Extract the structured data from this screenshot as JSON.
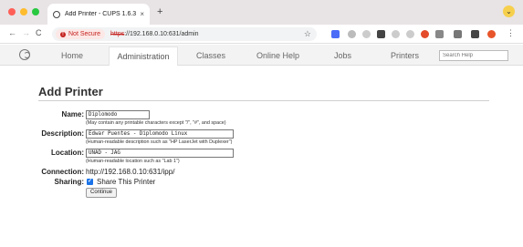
{
  "browser": {
    "tab_title": "Add Printer - CUPS 1.6.3",
    "tab_close": "×",
    "new_tab": "+",
    "security_label": "Not Secure",
    "url_protocol": "https",
    "url_rest": "://192.168.0.10:631/admin",
    "extension_icons": [
      "blue-square",
      "gray",
      "gray",
      "dark",
      "gray",
      "gray",
      "red",
      "gray",
      "gray",
      "gray",
      "red-avatar"
    ]
  },
  "nav": {
    "tabs": [
      "Home",
      "Administration",
      "Classes",
      "Online Help",
      "Jobs",
      "Printers"
    ],
    "active_tab": "Administration",
    "search_placeholder": "Search Help"
  },
  "page": {
    "title": "Add Printer",
    "name_label": "Name:",
    "name_value": "Diplomodo",
    "name_hint": "(May contain any printable characters except \"/\", \"#\", and space)",
    "description_label": "Description:",
    "description_value": "Edwar Puentes - Diplomodo Linux",
    "description_hint": "(Human-readable description such as \"HP LaserJet with Duplexer\")",
    "location_label": "Location:",
    "location_value": "UNAD - JAG",
    "location_hint": "(Human-readable location such as \"Lab 1\")",
    "connection_label": "Connection:",
    "connection_value": "http://192.168.0.10:631/ipp/",
    "sharing_label": "Sharing:",
    "sharing_checked": true,
    "sharing_text": "Share This Printer",
    "continue_label": "Continue"
  },
  "colors": {
    "accent": "#1a73e8",
    "not_secure": "#c5221f",
    "nav_bg": "#f3f3f3"
  }
}
